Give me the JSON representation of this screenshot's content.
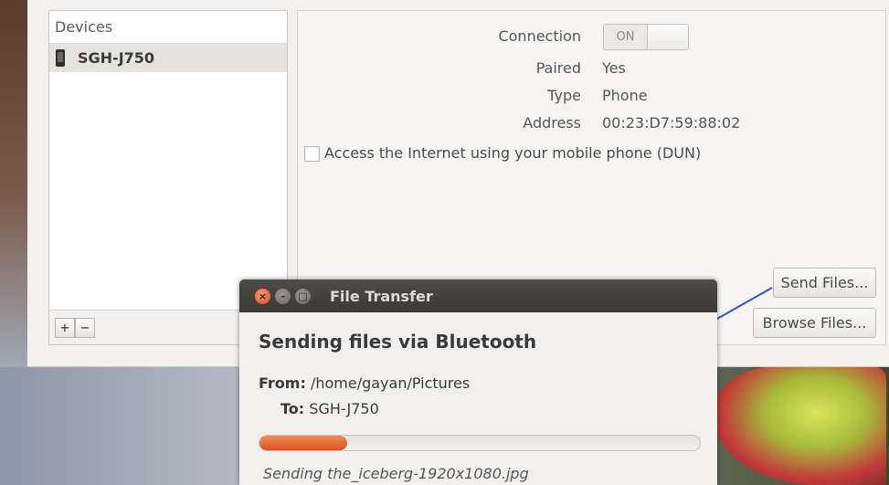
{
  "bluetooth": {
    "devices_header": "Devices",
    "devices": [
      {
        "name": "SGH-J750",
        "icon": "phone-icon"
      }
    ],
    "add_label": "+",
    "remove_label": "−",
    "details": {
      "connection_label": "Connection",
      "connection_state": "ON",
      "paired_label": "Paired",
      "paired_value": "Yes",
      "type_label": "Type",
      "type_value": "Phone",
      "address_label": "Address",
      "address_value": "00:23:D7:59:88:02",
      "dun_label": "Access the Internet using your mobile phone (DUN)",
      "dun_checked": false
    },
    "send_files_label": "Send Files...",
    "browse_files_label": "Browse Files..."
  },
  "dialog": {
    "title": "File Transfer",
    "heading": "Sending files via Bluetooth",
    "from_label": "From:",
    "from_value": "/home/gayan/Pictures",
    "to_label": "To:",
    "to_value": "SGH-J750",
    "progress": 0.2,
    "status": "Sending the_iceberg-1920x1080.jpg"
  },
  "colors": {
    "progress_fill": "#e06a32",
    "arrow": "#3b4fc8"
  }
}
